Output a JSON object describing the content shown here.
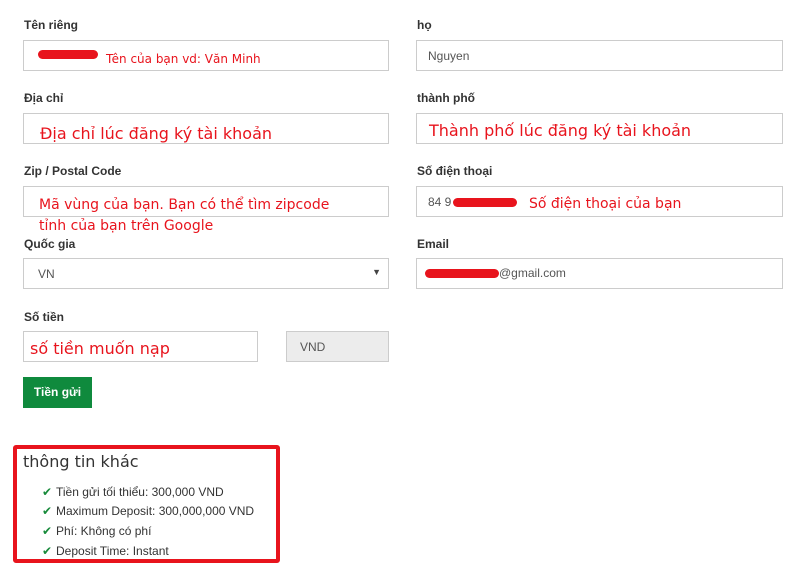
{
  "form": {
    "first_name": {
      "label": "Tên riêng",
      "hint": "Tên của bạn vd: Văn Minh"
    },
    "last_name": {
      "label": "họ",
      "value": "Nguyen"
    },
    "address": {
      "label": "Địa chỉ",
      "hint": "Địa chỉ lúc đăng ký tài khoản"
    },
    "city": {
      "label": "thành phố",
      "hint": "Thành phố lúc đăng ký tài khoản"
    },
    "zip": {
      "label": "Zip / Postal Code",
      "hint_line1": "Mã vùng của bạn. Bạn có thể tìm zipcode",
      "hint_line2": "tỉnh của bạn trên Google"
    },
    "phone": {
      "label": "Số điện thoại",
      "value_prefix": "84 9",
      "hint": "Số điện thoại của bạn"
    },
    "country": {
      "label": "Quốc gia",
      "value": "VN",
      "caret_icon": "chevron-down-icon"
    },
    "email": {
      "label": "Email",
      "value_suffix": "@gmail.com"
    },
    "amount": {
      "label": "Số tiền",
      "hint": "số tiền muốn nạp",
      "currency": "VND"
    },
    "submit_label": "Tiền gửi"
  },
  "info": {
    "title": "thông tin khác",
    "items": [
      "Tiền gửi tối thiểu: 300,000 VND",
      "Maximum Deposit: 300,000,000 VND",
      "Phí: Không có phí",
      "Deposit Time: Instant"
    ],
    "check_icon": "check-icon"
  },
  "colors": {
    "annotation_red": "#e8141d",
    "submit_green": "#0f8a3d",
    "check_green": "#178a3a"
  }
}
